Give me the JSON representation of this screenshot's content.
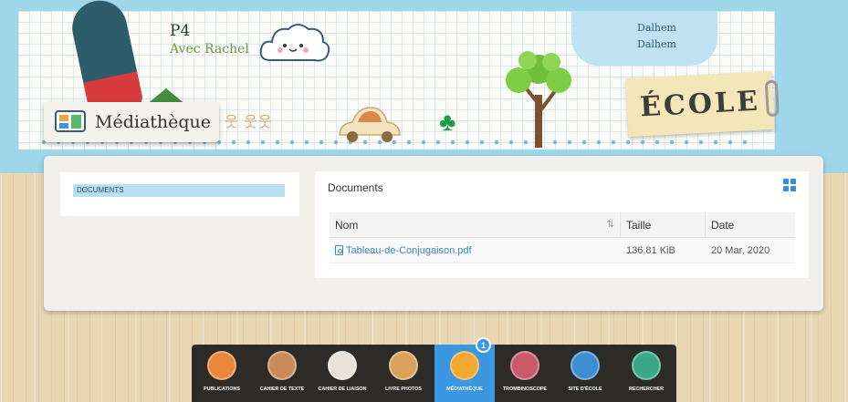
{
  "header": {
    "class_name": "P4",
    "teacher": "Avec Rachel",
    "city_line1": "Dalhem",
    "city_line2": "Dalhem",
    "sign_text": "ÉCOLE",
    "page_title": "Médiathèque"
  },
  "sidebar": {
    "folders": [
      {
        "label": "DOCUMENTS"
      }
    ]
  },
  "documents": {
    "title": "Documents",
    "columns": {
      "name": "Nom",
      "size": "Taille",
      "date": "Date"
    },
    "sort_icon": "sort-icon",
    "view_icon": "grid-view-icon",
    "rows": [
      {
        "name": "Tableau-de-Conjugaison.pdf",
        "size": "136.81 KiB",
        "date": "20 Mar, 2020"
      }
    ]
  },
  "dock": {
    "items": [
      {
        "label": "PUBLICATIONS",
        "color": "#e8873a"
      },
      {
        "label": "CAHIER DE TEXTE",
        "color": "#c98b5a"
      },
      {
        "label": "CAHIER DE LIAISON",
        "color": "#e8e2d8"
      },
      {
        "label": "LIVRE PHOTOS",
        "color": "#d9a15c"
      },
      {
        "label": "MÉDIATHÈQUE",
        "color": "#f0a830",
        "active": true
      },
      {
        "label": "TROMBINOSCOPE",
        "color": "#c85a6a"
      },
      {
        "label": "SITE D'ÉCOLE",
        "color": "#3a8fd0"
      },
      {
        "label": "RECHERCHER",
        "color": "#3aa887"
      }
    ],
    "badge_count": "1"
  },
  "colors": {
    "accent": "#3a97e0",
    "sky": "#9fd6ea",
    "link": "#3a86c8"
  }
}
